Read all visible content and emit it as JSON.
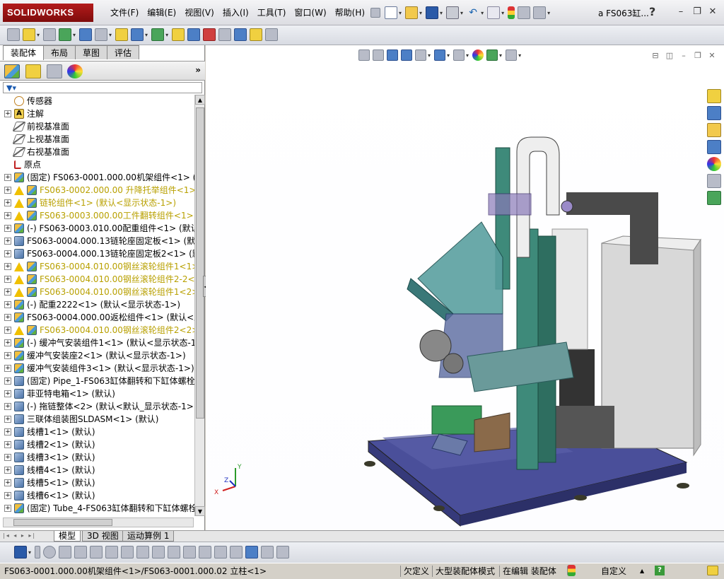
{
  "app": {
    "logo": "SOLIDWORKS",
    "doc_title": "a FS063缸...",
    "help": "?"
  },
  "menu": [
    "文件(F)",
    "编辑(E)",
    "视图(V)",
    "插入(I)",
    "工具(T)",
    "窗口(W)",
    "帮助(H)"
  ],
  "panel": {
    "tabs": [
      "装配体",
      "布局",
      "草图",
      "评估"
    ],
    "expand": "»"
  },
  "tree": [
    {
      "label": "传感器",
      "icon": "sensor",
      "exp": false,
      "warn": false
    },
    {
      "label": "注解",
      "icon": "note",
      "exp": true,
      "warn": false
    },
    {
      "label": "前视基准面",
      "icon": "plane",
      "exp": false,
      "warn": false
    },
    {
      "label": "上视基准面",
      "icon": "plane",
      "exp": false,
      "warn": false
    },
    {
      "label": "右视基准面",
      "icon": "plane",
      "exp": false,
      "warn": false
    },
    {
      "label": "原点",
      "icon": "origin",
      "exp": false,
      "warn": false
    },
    {
      "label": "(固定) FS063-0001.000.00机架组件<1> (默",
      "icon": "asm",
      "exp": true,
      "warn": false
    },
    {
      "label": "FS063-0002.000.00 升降托举组件<1> (默",
      "icon": "asm",
      "exp": true,
      "warn": true
    },
    {
      "label": "链轮组件<1> (默认<显示状态-1>)",
      "icon": "asm",
      "exp": true,
      "warn": true
    },
    {
      "label": "FS063-0003.000.00工件翻转组件<1> (默",
      "icon": "asm",
      "exp": true,
      "warn": true
    },
    {
      "label": "(-) FS063-0003.010.00配重组件<1> (默认",
      "icon": "asm",
      "exp": true,
      "warn": false
    },
    {
      "label": "FS063-0004.000.13链轮座固定板<1> (默认",
      "icon": "part",
      "exp": true,
      "warn": false
    },
    {
      "label": "FS063-0004.000.13链轮座固定板2<1> (默认",
      "icon": "part",
      "exp": true,
      "warn": false
    },
    {
      "label": "FS063-0004.010.00钢丝滚轮组件1<1> (默",
      "icon": "asm",
      "exp": true,
      "warn": true
    },
    {
      "label": "FS063-0004.010.00钢丝滚轮组件2-2<1> (",
      "icon": "asm",
      "exp": true,
      "warn": true
    },
    {
      "label": "FS063-0004.010.00钢丝滚轮组件1<2> (默",
      "icon": "asm",
      "exp": true,
      "warn": true
    },
    {
      "label": "(-) 配重2222<1> (默认<显示状态-1>)",
      "icon": "asm",
      "exp": true,
      "warn": false
    },
    {
      "label": "FS063-0004.000.00返松组件<1> (默认<显示",
      "icon": "asm",
      "exp": true,
      "warn": false
    },
    {
      "label": "FS063-0004.010.00钢丝滚轮组件2<2> (默",
      "icon": "asm",
      "exp": true,
      "warn": true
    },
    {
      "label": "(-) 缓冲气安装组件1<1> (默认<显示状态-1",
      "icon": "asm",
      "exp": true,
      "warn": false
    },
    {
      "label": "缓冲气安装座2<1> (默认<显示状态-1>)",
      "icon": "asm",
      "exp": true,
      "warn": false
    },
    {
      "label": "缓冲气安装组件3<1> (默认<显示状态-1>)",
      "icon": "asm",
      "exp": true,
      "warn": false
    },
    {
      "label": "(固定) Pipe_1-FS063缸体翻转和下缸体螺栓",
      "icon": "part",
      "exp": true,
      "warn": false
    },
    {
      "label": "菲亚特电箱<1> (默认)",
      "icon": "part",
      "exp": true,
      "warn": false
    },
    {
      "label": "(-) 拖链整体<2> (默认<默认_显示状态-1>",
      "icon": "part",
      "exp": true,
      "warn": false
    },
    {
      "label": "三联体组装图SLDASM<1> (默认)",
      "icon": "part",
      "exp": true,
      "warn": false
    },
    {
      "label": "线槽1<1> (默认)",
      "icon": "part",
      "exp": true,
      "warn": false
    },
    {
      "label": "线槽2<1> (默认)",
      "icon": "part",
      "exp": true,
      "warn": false
    },
    {
      "label": "线槽3<1> (默认)",
      "icon": "part",
      "exp": true,
      "warn": false
    },
    {
      "label": "线槽4<1> (默认)",
      "icon": "part",
      "exp": true,
      "warn": false
    },
    {
      "label": "线槽5<1> (默认)",
      "icon": "part",
      "exp": true,
      "warn": false
    },
    {
      "label": "线槽6<1> (默认)",
      "icon": "part",
      "exp": true,
      "warn": false
    },
    {
      "label": "(固定) Tube_4-FS063缸体翻转和下缸体螺栓",
      "icon": "asm",
      "exp": true,
      "warn": false
    }
  ],
  "bottom_tabs": [
    "模型",
    "3D 视图",
    "运动算例 1"
  ],
  "status": {
    "path": "FS063-0001.000.00机架组件<1>/FS063-0001.000.02 立柱<1>",
    "defined": "欠定义",
    "mode": "大型装配体模式",
    "editing": "在编辑 装配体",
    "custom": "自定义"
  },
  "triad": {
    "x": "X",
    "y": "Y",
    "z": "Z"
  }
}
